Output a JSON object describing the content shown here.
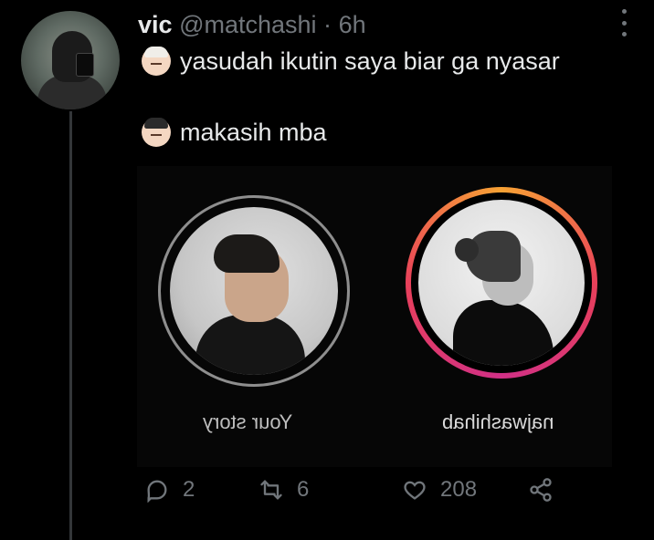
{
  "tweet": {
    "display_name": "vic",
    "handle": "@matchashi",
    "separator": "·",
    "time": "6h",
    "lines": [
      {
        "emoji": "woman-light-skin-icon",
        "text": "yasudah ikutin saya biar ga nyasar"
      },
      {
        "emoji": "man-light-skin-icon",
        "text": "makasih mba"
      }
    ]
  },
  "media": {
    "stories": [
      {
        "label": "Your story"
      },
      {
        "label": "najwashihab"
      }
    ]
  },
  "actions": {
    "replies": "2",
    "retweets": "6",
    "likes": "208"
  },
  "colors": {
    "background": "#000000",
    "muted": "#71767b",
    "text": "#e7e9ea",
    "story_ring_start": "#f7a234",
    "story_ring_end": "#d13086"
  }
}
